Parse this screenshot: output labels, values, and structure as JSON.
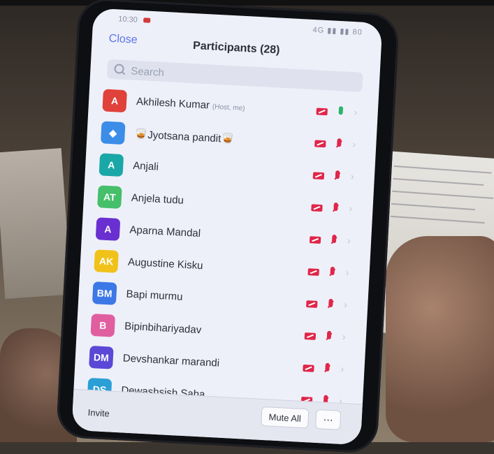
{
  "status_bar": {
    "time": "10:30",
    "signal_text": "4G  ▮▮  ▮▮  80"
  },
  "header": {
    "close_label": "Close",
    "title": "Participants (28)"
  },
  "search": {
    "placeholder": "Search"
  },
  "participants": [
    {
      "initials": "A",
      "name": "Akhilesh Kumar",
      "tag": "(Host, me)",
      "color": "#e0413a",
      "video": "off",
      "mic": "on"
    },
    {
      "initials": "◆",
      "name": "🥃Jyotsana pandit🥃",
      "tag": "",
      "color": "#3b8de8",
      "video": "off",
      "mic": "off"
    },
    {
      "initials": "A",
      "name": "Anjali",
      "tag": "",
      "color": "#1aa7a7",
      "video": "off",
      "mic": "off"
    },
    {
      "initials": "AT",
      "name": "Anjela tudu",
      "tag": "",
      "color": "#45bf6a",
      "video": "off",
      "mic": "off"
    },
    {
      "initials": "A",
      "name": "Aparna Mandal",
      "tag": "",
      "color": "#6a2fd0",
      "video": "off",
      "mic": "off"
    },
    {
      "initials": "AK",
      "name": "Augustine Kisku",
      "tag": "",
      "color": "#f0c21a",
      "video": "off",
      "mic": "off"
    },
    {
      "initials": "BM",
      "name": "Bapi murmu",
      "tag": "",
      "color": "#3c78e6",
      "video": "off",
      "mic": "off"
    },
    {
      "initials": "B",
      "name": "Bipinbihariyadav",
      "tag": "",
      "color": "#e05ea0",
      "video": "off",
      "mic": "off"
    },
    {
      "initials": "DM",
      "name": "Devshankar marandi",
      "tag": "",
      "color": "#5b48d6",
      "video": "off",
      "mic": "off"
    },
    {
      "initials": "DS",
      "name": "Dewashsish Saha",
      "tag": "",
      "color": "#2a9fd6",
      "video": "off",
      "mic": "off"
    }
  ],
  "bottom_bar": {
    "invite_label": "Invite",
    "mute_all_label": "Mute All",
    "more_label": "⋯"
  },
  "colors": {
    "accent": "#5a74e8",
    "muted_red": "#e0264a",
    "mic_on_green": "#2bb36a"
  }
}
